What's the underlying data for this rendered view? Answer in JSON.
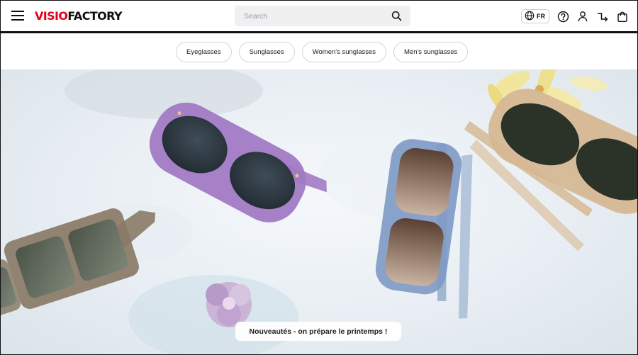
{
  "brand": {
    "logo_red": "VISIO",
    "logo_black": "FACTORY",
    "accent": "#e3001b"
  },
  "header": {
    "menu_icon": "hamburger-menu-icon",
    "search": {
      "placeholder": "Search",
      "icon": "search-icon"
    },
    "language": {
      "code": "FR",
      "icon": "globe-icon"
    },
    "icons": [
      "help-icon",
      "account-icon",
      "store-locator-icon",
      "cart-icon"
    ]
  },
  "categories": [
    {
      "label": "Eyeglasses"
    },
    {
      "label": "Sunglasses"
    },
    {
      "label": "Women's sunglasses"
    },
    {
      "label": "Men's sunglasses"
    }
  ],
  "hero": {
    "caption": "Nouveautés - on prépare le printemps !",
    "frame_colors": [
      "#8a7a66",
      "#a27ac4",
      "#7d99c4",
      "#d6b894"
    ]
  }
}
